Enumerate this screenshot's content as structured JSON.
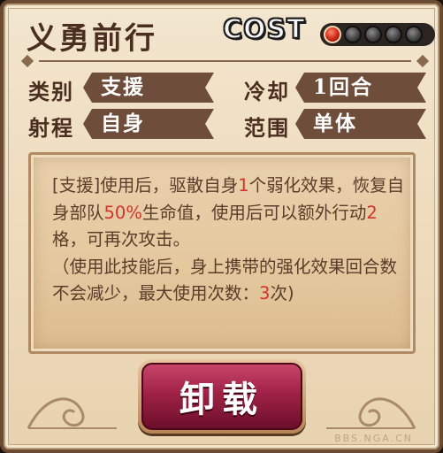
{
  "skill": {
    "name": "义勇前行",
    "cost_label": "COST",
    "cost_value": 1,
    "cost_max": 5
  },
  "fields": {
    "category_label": "类别",
    "category_value": "支援",
    "cooldown_label": "冷却",
    "cooldown_value": "1回合",
    "range_label": "射程",
    "range_value": "自身",
    "scope_label": "范围",
    "scope_value": "单体"
  },
  "description": {
    "p1_a": "[支援]使用后，驱散自身",
    "p1_hl1": "1",
    "p1_b": "个弱化效果，恢复自身部队",
    "p1_hl2": "50%",
    "p1_c": "生命值，使用后可以额外行动",
    "p1_hl3": "2",
    "p1_d": "格，可再次攻击。",
    "p2_a": "（使用此技能后，身上携带的强化效果回合数不会减少，最大使用次数：",
    "p2_hl": "3",
    "p2_b": "次)"
  },
  "button": {
    "unload_label": "卸载"
  },
  "watermark": "BBS.NGA.CN",
  "colors": {
    "highlight": "#d0342c",
    "button": "#a02246",
    "cost_active": "#d22a18"
  }
}
